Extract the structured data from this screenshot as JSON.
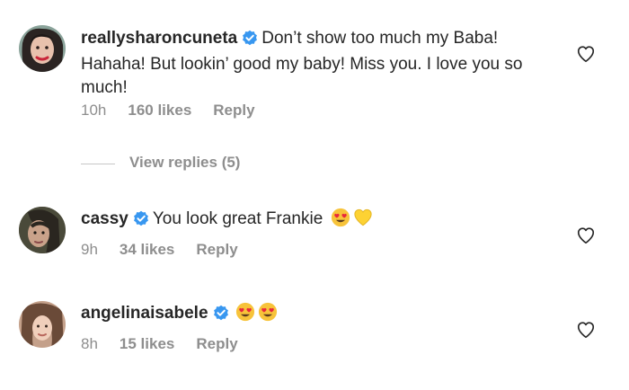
{
  "comments": [
    {
      "username": "reallysharoncuneta",
      "text": "Don’t show too much my Baba! Hahaha! But lookin’ good my baby! Miss you. I love you so much!",
      "time": "10h",
      "likes": "160 likes",
      "reply": "Reply"
    },
    {
      "username": "cassy",
      "text": "You look great Frankie",
      "time": "9h",
      "likes": "34 likes",
      "reply": "Reply"
    },
    {
      "username": "angelinaisabele",
      "text": "",
      "time": "8h",
      "likes": "15 likes",
      "reply": "Reply"
    }
  ],
  "view_replies": "View replies (5)",
  "colors": {
    "verified": "#3897f0",
    "muted": "#8e8e8e",
    "heart_stroke": "#262626"
  },
  "icons": {
    "verified": "verified-badge-icon",
    "heart": "heart-outline-icon",
    "emoji_heart_eyes": "heart-eyes-emoji",
    "emoji_yellow_heart": "yellow-heart-emoji"
  }
}
